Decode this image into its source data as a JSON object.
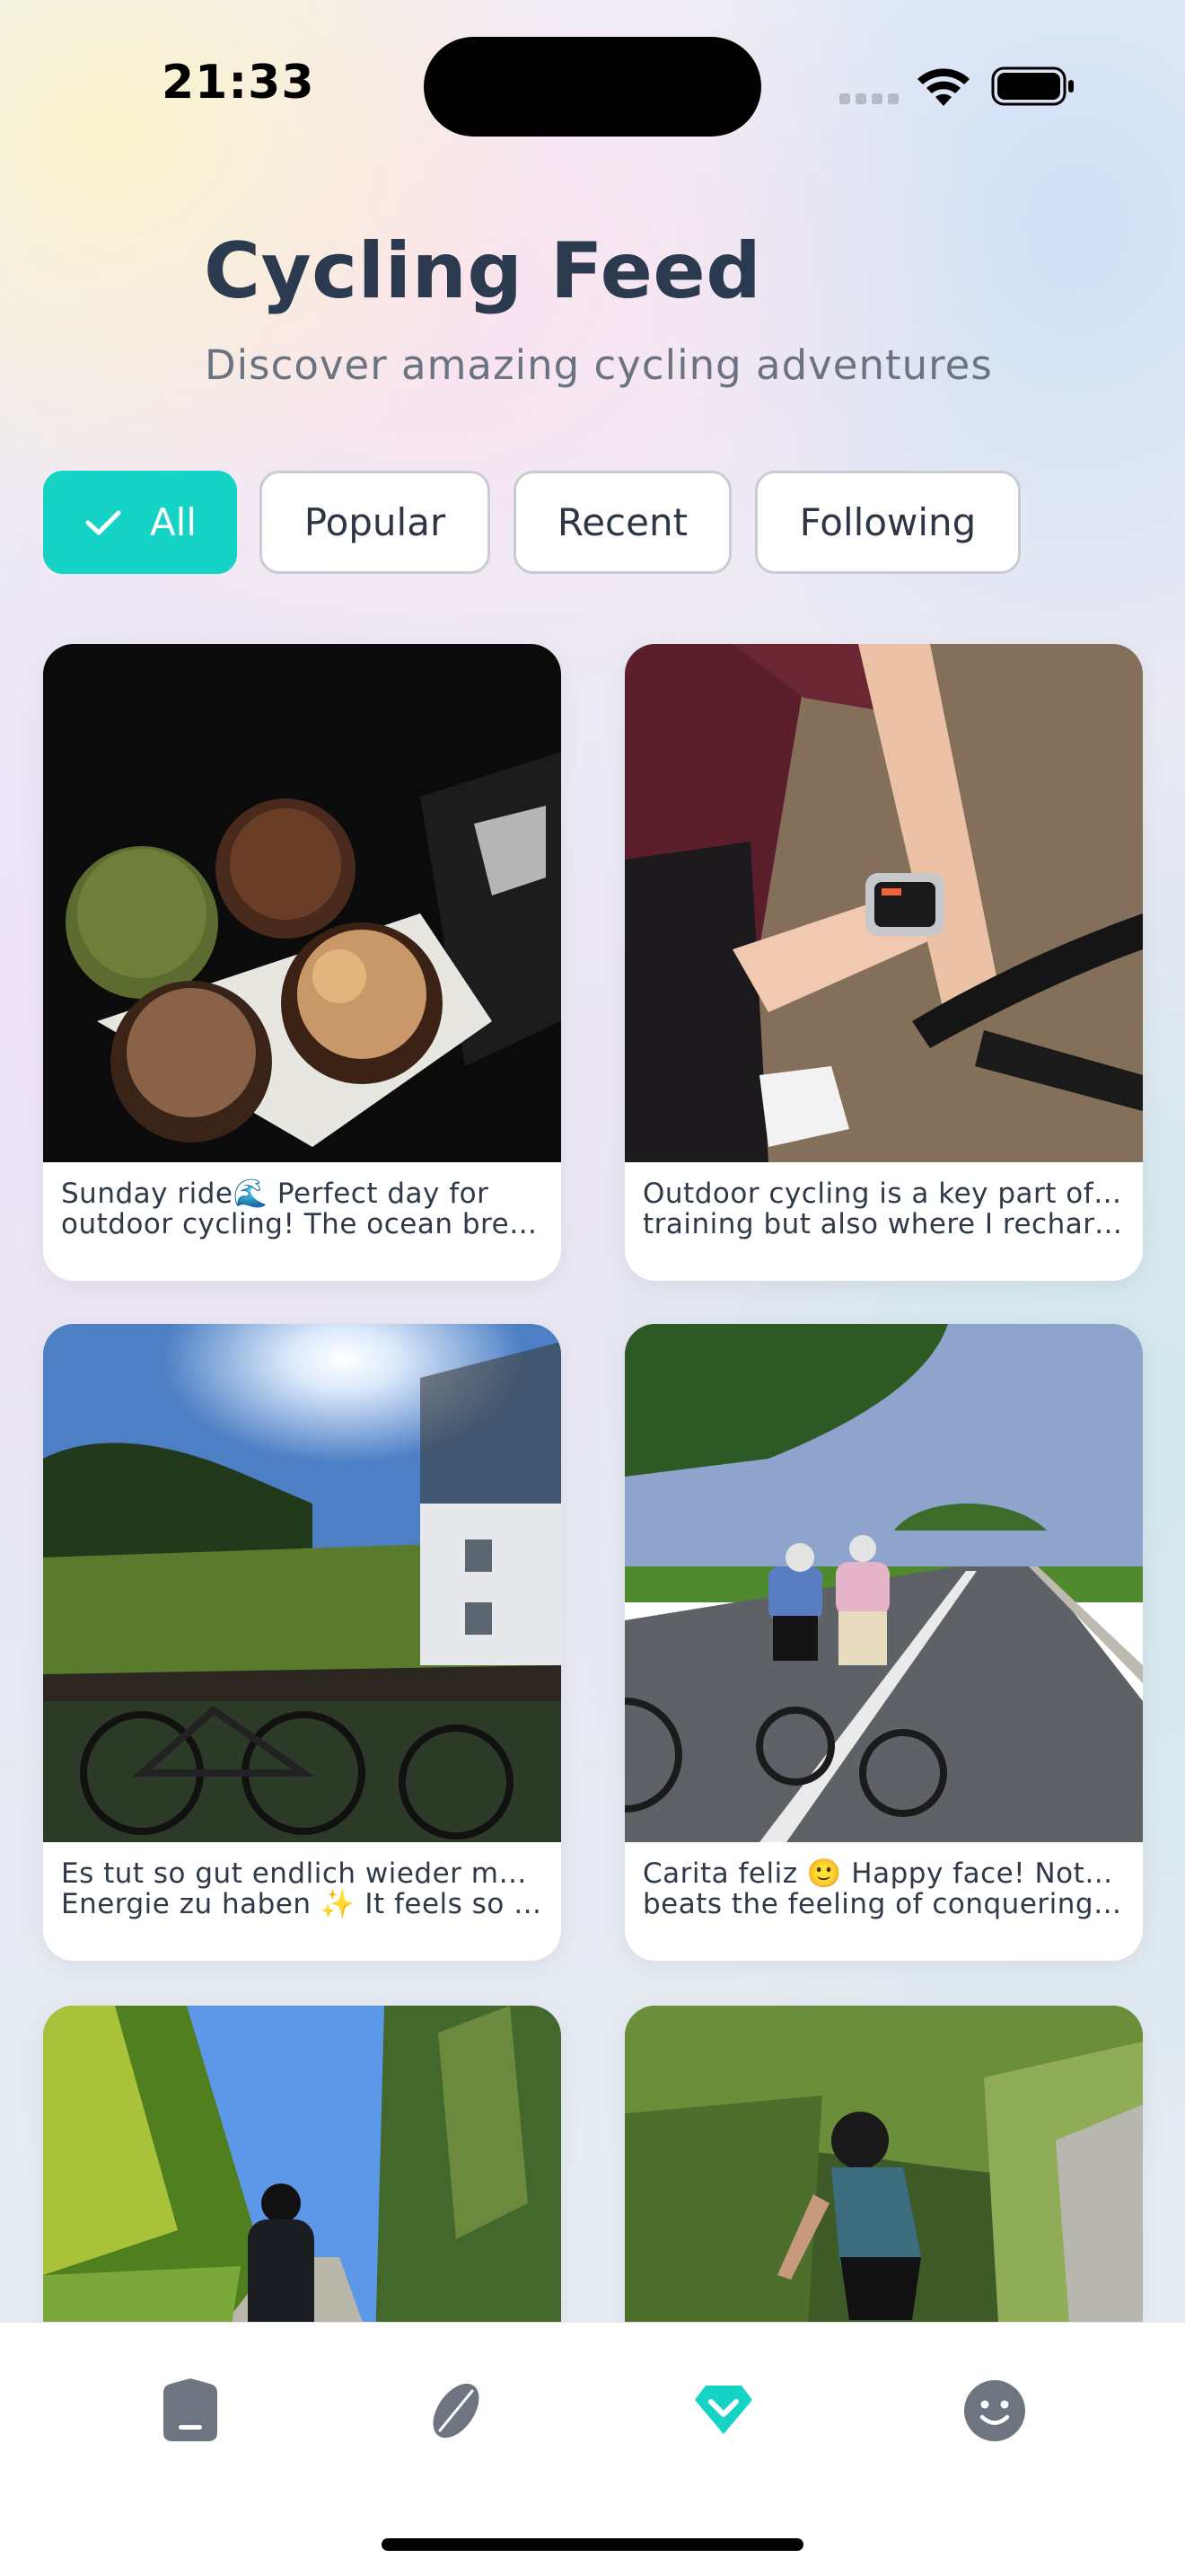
{
  "status_bar": {
    "time": "21:33"
  },
  "header": {
    "title": "Cycling Feed",
    "subtitle": "Discover amazing cycling adventures"
  },
  "filters": [
    {
      "label": "All",
      "active": true
    },
    {
      "label": "Popular",
      "active": false
    },
    {
      "label": "Recent",
      "active": false
    },
    {
      "label": "Following",
      "active": false
    }
  ],
  "posts": [
    {
      "line1": "Sunday ride🌊 Perfect day for",
      "line2": "outdoor cycling! The ocean breez…"
    },
    {
      "line1": "Outdoor cycling is a key part of my",
      "line2": "training but also where I recharge…"
    },
    {
      "line1": "Es tut so gut endlich wieder mehr",
      "line2": "Energie zu haben ✨ It feels so g…"
    },
    {
      "line1": "Carita feliz 🙂 Happy face! Nothing",
      "line2": "beats the feeling of conquering a …"
    }
  ],
  "tabbar": {
    "items": [
      "home-icon",
      "explore-icon",
      "feed-icon",
      "profile-icon"
    ],
    "active": "feed-icon"
  },
  "colors": {
    "accent": "#15d3c5",
    "tab_inactive": "#6e7580"
  }
}
